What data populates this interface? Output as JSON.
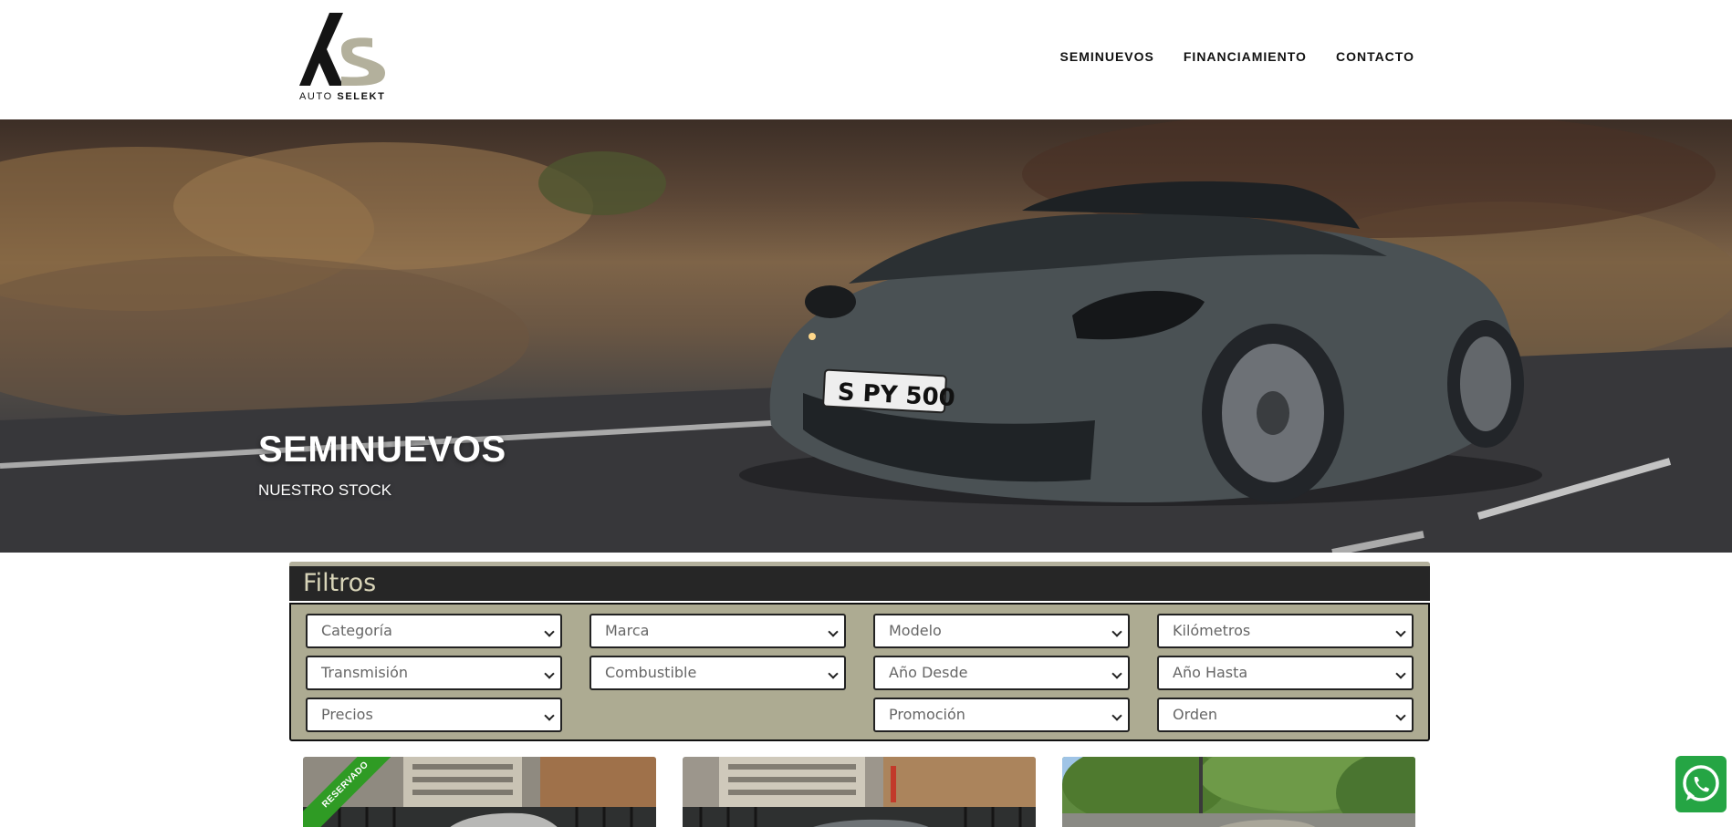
{
  "brand": {
    "word1": "AUTO",
    "word2": "SELEKT"
  },
  "nav": [
    {
      "label": "SEMINUEVOS"
    },
    {
      "label": "FINANCIAMIENTO"
    },
    {
      "label": "CONTACTO"
    }
  ],
  "hero": {
    "title": "SEMINUEVOS",
    "subtitle": "NUESTRO STOCK",
    "plate": "S PY 500"
  },
  "filters": {
    "title": "Filtros",
    "selects": [
      "Categoría",
      "Marca",
      "Modelo",
      "Kilómetros",
      "Transmisión",
      "Combustible",
      "Año Desde",
      "Año Hasta",
      "Precios",
      "Promoción",
      "Orden"
    ]
  },
  "cards": [
    {
      "ribbon": "RESERVADO"
    },
    {
      "ribbon": ""
    },
    {
      "ribbon": ""
    }
  ],
  "colors": {
    "accent": "#adab92",
    "dark": "#262626",
    "ribbon": "#2f9b24",
    "whatsapp": "#25a544"
  },
  "icons": {
    "whatsapp": "whatsapp-icon"
  }
}
